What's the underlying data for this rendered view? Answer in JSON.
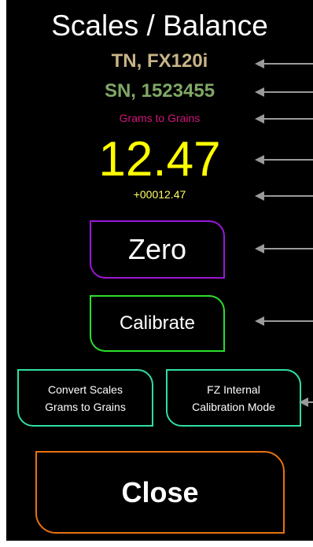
{
  "header": {
    "title": "Scales / Balance"
  },
  "device": {
    "tn_label": "TN, FX120i",
    "sn_label": "SN, 1523455",
    "mode_label": "Grams to Grains"
  },
  "readout": {
    "value": "12.47",
    "raw": "+00012.47"
  },
  "buttons": {
    "zero": "Zero",
    "calibrate": "Calibrate",
    "convert_line1": "Convert Scales",
    "convert_line2": "Grams to Grains",
    "fz_line1": "FZ Internal",
    "fz_line2": "Calibration Mode",
    "close": "Close"
  },
  "colors": {
    "tn": "#c8b488",
    "sn": "#7fa866",
    "mode": "#d0147a",
    "reading": "#ffff00",
    "zero_border": "#9b16d8",
    "calibrate_border": "#2adf2a",
    "convert_border": "#2ee0a0",
    "close_border": "#e8720f",
    "pointer": "#9a9a9a"
  },
  "icons": {
    "pointer_arrows": "left-arrow-icon"
  }
}
